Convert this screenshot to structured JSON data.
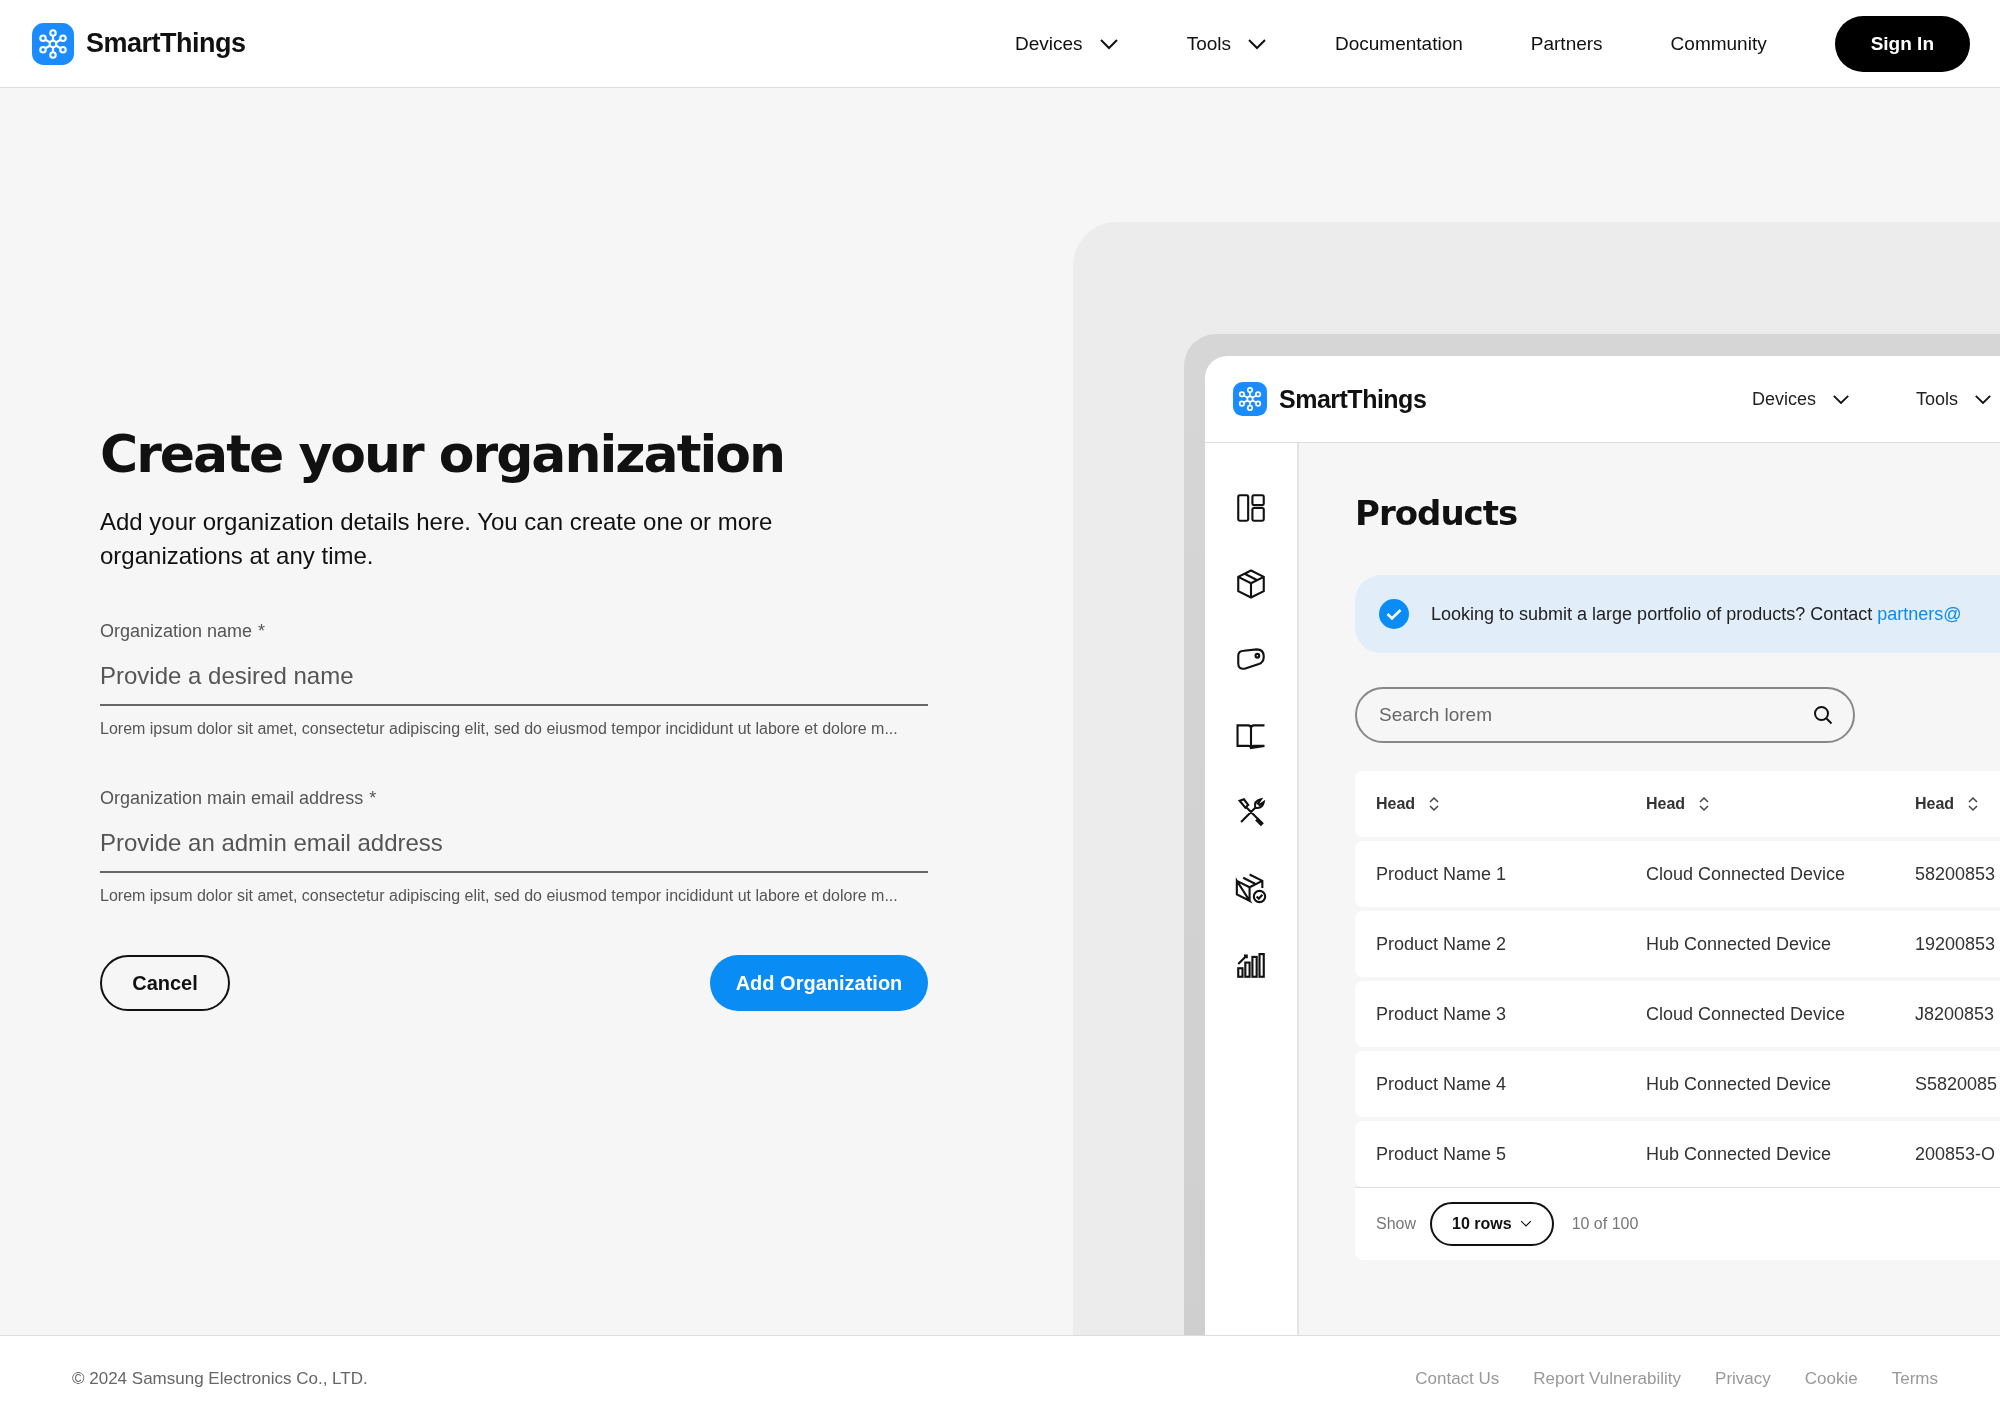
{
  "header": {
    "brand": "SmartThings",
    "nav": [
      {
        "label": "Devices",
        "kind": "dropdown"
      },
      {
        "label": "Tools",
        "kind": "dropdown"
      },
      {
        "label": "Documentation",
        "kind": "link"
      },
      {
        "label": "Partners",
        "kind": "link"
      },
      {
        "label": "Community",
        "kind": "link"
      }
    ],
    "sign_in": "Sign In"
  },
  "form": {
    "title": "Create your organization",
    "description": "Add your organization details here. You can create one or more organizations at any time.",
    "fields": [
      {
        "label": "Organization name",
        "required_mark": "*",
        "placeholder": "Provide a desired name",
        "helper": "Lorem ipsum dolor sit amet, consectetur adipiscing elit, sed do eiusmod tempor incididunt ut labore et dolore m..."
      },
      {
        "label": "Organization main email address",
        "required_mark": "*",
        "placeholder": "Provide an admin email address",
        "helper": "Lorem ipsum dolor sit amet, consectetur adipiscing elit, sed do eiusmod tempor incididunt ut labore et dolore m..."
      }
    ],
    "cancel": "Cancel",
    "submit": "Add Organization"
  },
  "preview": {
    "brand": "SmartThings",
    "nav": [
      {
        "label": "Devices",
        "kind": "dropdown"
      },
      {
        "label": "Tools",
        "kind": "dropdown"
      }
    ],
    "page_title": "Products",
    "banner": {
      "text": "Looking to submit a large portfolio of products? Contact ",
      "link": "partners@"
    },
    "search": {
      "placeholder": "Search lorem"
    },
    "table": {
      "columns": [
        "Head",
        "Head",
        "Head"
      ],
      "rows": [
        [
          "Product Name 1",
          "Cloud Connected Device",
          "58200853"
        ],
        [
          "Product Name 2",
          "Hub Connected Device",
          "19200853"
        ],
        [
          "Product Name 3",
          "Cloud Connected Device",
          "J8200853"
        ],
        [
          "Product Name 4",
          "Hub Connected Device",
          "S5820085"
        ],
        [
          "Product Name 5",
          "Hub Connected Device",
          "200853-O"
        ]
      ]
    },
    "pagination": {
      "show_label": "Show",
      "rows_select": "10 rows",
      "range": "10 of 100"
    }
  },
  "footer": {
    "copyright": "© 2024 Samsung Electronics Co., LTD.",
    "links": [
      "Contact Us",
      "Report Vulnerability",
      "Privacy",
      "Cookie",
      "Terms"
    ]
  }
}
